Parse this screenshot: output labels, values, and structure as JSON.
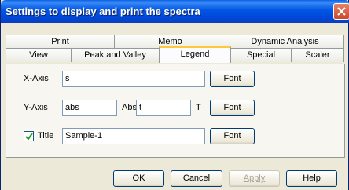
{
  "window": {
    "title": "Settings to display and print the spectra"
  },
  "tabs": {
    "row_back": [
      "Print",
      "Memo",
      "Dynamic Analysis"
    ],
    "row_front": [
      "View",
      "Peak and Valley",
      "Legend",
      "Special",
      "Scaler"
    ],
    "active": "Legend"
  },
  "legend": {
    "x_axis": {
      "label": "X-Axis",
      "value": "s",
      "font_button": "Font"
    },
    "y_axis": {
      "label": "Y-Axis",
      "value": "abs",
      "mid_label": "Abs",
      "value2": "t",
      "suffix_label": "T",
      "font_button": "Font"
    },
    "title": {
      "checked": true,
      "label": "Title",
      "value": "Sample-1",
      "font_button": "Font"
    }
  },
  "footer": {
    "ok": "OK",
    "cancel": "Cancel",
    "apply": "Apply",
    "help": "Help"
  },
  "colors": {
    "titlebar": "#0055e5",
    "dialog_bg": "#ece9d8",
    "active_tab_accent": "#ffc73c",
    "close_button": "#c94a2c"
  }
}
